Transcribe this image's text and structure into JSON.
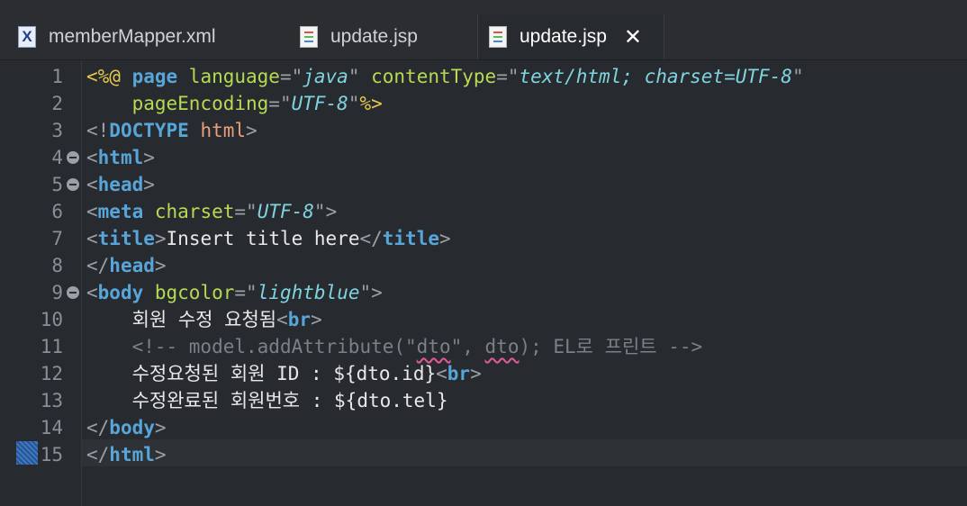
{
  "tabs": [
    {
      "label": "memberMapper.xml",
      "icon": "xml-file-icon",
      "active": false
    },
    {
      "label": "update.jsp",
      "icon": "jsp-file-icon",
      "active": false
    },
    {
      "label": "update.jsp",
      "icon": "jsp-file-icon",
      "active": true
    }
  ],
  "gutter": {
    "numbers": [
      "1",
      "2",
      "3",
      "4",
      "5",
      "6",
      "7",
      "8",
      "9",
      "10",
      "11",
      "12",
      "13",
      "14",
      "15"
    ]
  },
  "code": {
    "l1": {
      "open": "<%@ ",
      "page": "page ",
      "a1": "language",
      "eq1": "=\"",
      "v1": "java",
      "q1": "\" ",
      "a2": "contentType",
      "eq2": "=\"",
      "v2": "text/html; charset=UTF-8",
      "q2": "\""
    },
    "l2": {
      "indent": "    ",
      "a1": "pageEncoding",
      "eq1": "=\"",
      "v1": "UTF-8",
      "q1": "\"",
      "close": "%>"
    },
    "l3": {
      "lt": "<!",
      "doctype": "DOCTYPE ",
      "html": "html",
      "gt": ">"
    },
    "l4": {
      "lt": "<",
      "tag": "html",
      "gt": ">"
    },
    "l5": {
      "lt": "<",
      "tag": "head",
      "gt": ">"
    },
    "l6": {
      "lt": "<",
      "tag": "meta ",
      "a1": "charset",
      "eq1": "=\"",
      "v1": "UTF-8",
      "q1": "\"",
      "gt": ">"
    },
    "l7": {
      "lt": "<",
      "tag": "title",
      "gt": ">",
      "text": "Insert title here",
      "lt2": "</",
      "tag2": "title",
      "gt2": ">"
    },
    "l8": {
      "lt": "</",
      "tag": "head",
      "gt": ">"
    },
    "l9": {
      "lt": "<",
      "tag": "body ",
      "a1": "bgcolor",
      "eq1": "=\"",
      "v1": "lightblue",
      "q1": "\"",
      "gt": ">"
    },
    "l10": {
      "indent": "    ",
      "text": "회원 수정 요청됨",
      "lt": "<",
      "tag": "br",
      "gt": ">"
    },
    "l11": {
      "indent": "    ",
      "c1": "<!-- model.addAttribute(\"",
      "sq1": "dto",
      "c2": "\", ",
      "sq2": "dto",
      "c3": "); EL로 프린트 -->"
    },
    "l12": {
      "indent": "    ",
      "text": "수정요청된 회원 ID : ${dto.id}",
      "lt": "<",
      "tag": "br",
      "gt": ">"
    },
    "l13": {
      "indent": "    ",
      "text": "수정완료된 회원번호 : ${dto.tel}"
    },
    "l14": {
      "lt": "</",
      "tag": "body",
      "gt": ">"
    },
    "l15": {
      "lt": "</",
      "tag": "html",
      "gt": ">"
    }
  },
  "colors": {
    "background": "#272a2e",
    "directive": "#e6c84e",
    "tag": "#58a6d9",
    "attribute": "#b7da54",
    "value": "#7fd4e0",
    "comment": "#7c8087",
    "text": "#e8e8e8"
  }
}
